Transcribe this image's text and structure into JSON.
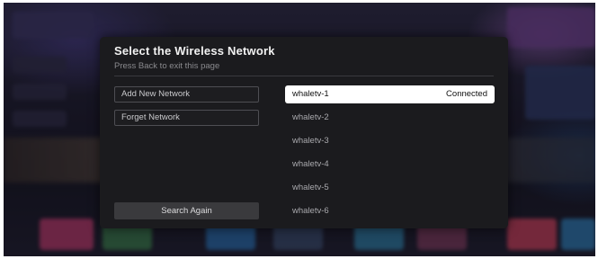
{
  "dialog": {
    "title": "Select the Wireless Network",
    "subtitle": "Press Back to exit this page"
  },
  "actions": {
    "add_new": "Add New Network",
    "forget": "Forget Network",
    "search_again": "Search Again"
  },
  "networks": [
    {
      "name": "whaletv-1",
      "status": "Connected",
      "selected": true
    },
    {
      "name": "whaletv-2",
      "status": ""
    },
    {
      "name": "whaletv-3",
      "status": ""
    },
    {
      "name": "whaletv-4",
      "status": ""
    },
    {
      "name": "whaletv-5",
      "status": ""
    },
    {
      "name": "whaletv-6",
      "status": ""
    }
  ],
  "colors": {
    "dialog_bg": "#1b1b1e",
    "selected_bg": "#ffffff",
    "text_muted": "#a9a9ad"
  }
}
